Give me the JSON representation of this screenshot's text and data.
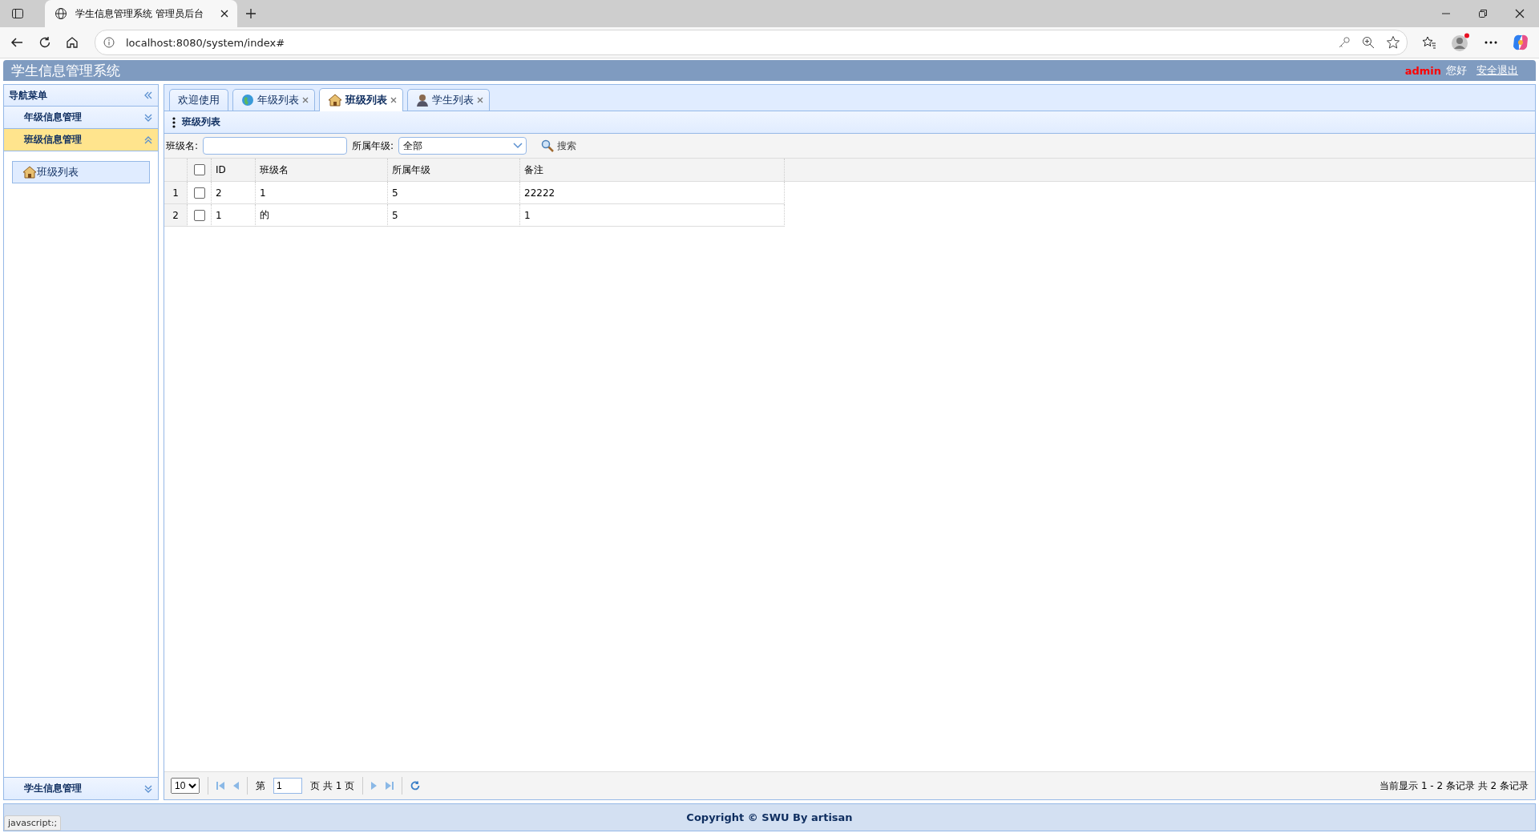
{
  "browser": {
    "tab_title": "学生信息管理系统 管理员后台",
    "address": "localhost:8080/system/index#"
  },
  "header": {
    "title": "学生信息管理系统",
    "user": "admin",
    "greeting": "您好",
    "logout": "安全退出"
  },
  "sidebar": {
    "title": "导航菜单",
    "sections": [
      {
        "label": "年级信息管理",
        "expanded": false
      },
      {
        "label": "班级信息管理",
        "expanded": true,
        "items": [
          {
            "label": "班级列表",
            "selected": true
          }
        ]
      }
    ],
    "bottom_section": {
      "label": "学生信息管理",
      "expanded": false
    }
  },
  "tabs": [
    {
      "label": "欢迎使用",
      "selected": false,
      "closable": false,
      "kind": "plain"
    },
    {
      "label": "年级列表",
      "selected": false,
      "closable": true,
      "kind": "globe"
    },
    {
      "label": "班级列表",
      "selected": true,
      "closable": true,
      "kind": "house"
    },
    {
      "label": "学生列表",
      "selected": false,
      "closable": true,
      "kind": "person"
    }
  ],
  "panel": {
    "title": "班级列表"
  },
  "toolbar": {
    "name_label": "班级名:",
    "grade_label": "所属年级:",
    "grade_value": "全部",
    "search": "搜索"
  },
  "table": {
    "all_checked": false,
    "columns": [
      "ID",
      "班级名",
      "所属年级",
      "备注"
    ],
    "rows": [
      {
        "num": "1",
        "checked": false,
        "cells": [
          "2",
          "1",
          "5",
          "22222"
        ]
      },
      {
        "num": "2",
        "checked": false,
        "cells": [
          "1",
          "的",
          "5",
          "1"
        ]
      }
    ]
  },
  "pager": {
    "page_size": "10",
    "page_prefix": "第",
    "page": "1",
    "page_suffix": "页 共 1 页",
    "summary": "当前显示 1 - 2 条记录 共 2 条记录"
  },
  "footer": {
    "copyright": "Copyright © SWU By artisan"
  },
  "status_bar": "javascript:;"
}
